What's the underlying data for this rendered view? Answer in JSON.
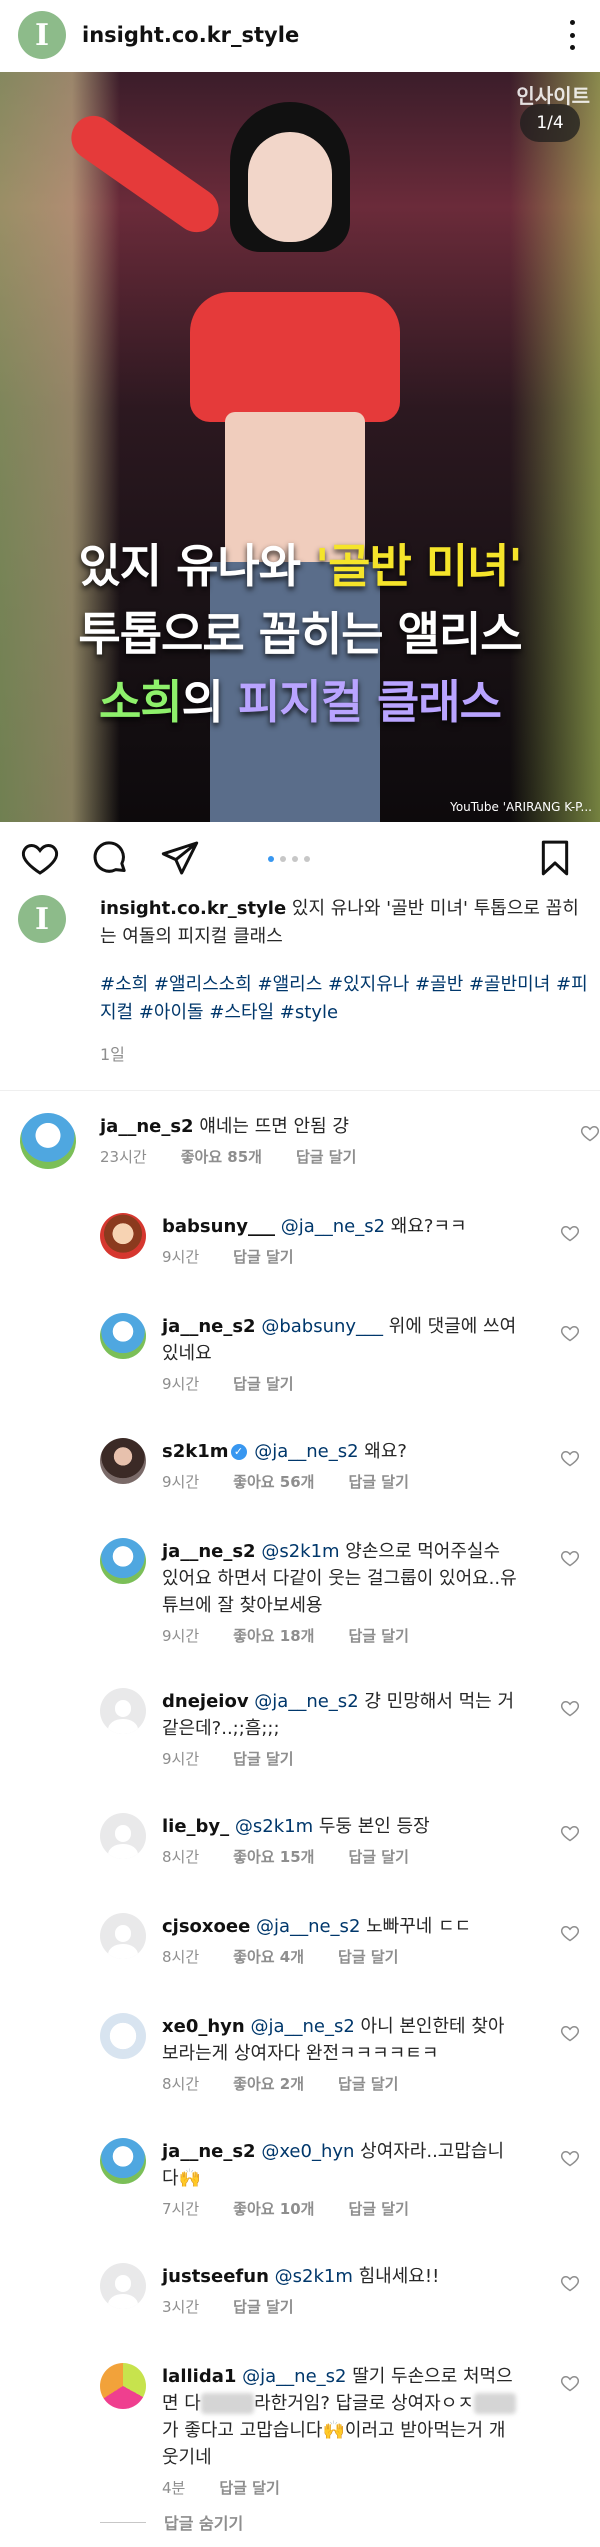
{
  "header": {
    "username": "insight.co.kr_style",
    "logo_letter": "I"
  },
  "media": {
    "counter": "1/4",
    "watermark": "인사이트",
    "caption_line1_a": "있지 유나와 ",
    "caption_line1_b": "'골반 미녀'",
    "caption_line2": "투톱으로 꼽히는 앨리스",
    "caption_line3_a": "소희",
    "caption_line3_b": "의 ",
    "caption_line3_c": "피지컬 클래스",
    "source": "YouTube 'ARIRANG K-P..."
  },
  "post": {
    "username": "insight.co.kr_style",
    "text": " 있지 유나와 '골반 미녀' 투톱으로 꼽히는 여돌의 피지컬 클래스",
    "tags": "#소희 #앨리스소희 #앨리스 #있지유나 #골반 #골반미녀 #피지컬 #아이돌 #스타일 #style",
    "time": "1일"
  },
  "comments": [
    {
      "user": "ja__ne_s2",
      "mention": "",
      "text": "얘네는 뜨면 안됨 걍",
      "time": "23시간",
      "likes": "좋아요 85개",
      "reply": "답글 달기"
    },
    {
      "user": "babsuny___",
      "mention": "@ja__ne_s2",
      "text": " 왜요?ㅋㅋ",
      "time": "9시간",
      "likes": "",
      "reply": "답글 달기"
    },
    {
      "user": "ja__ne_s2",
      "mention": "@babsuny___",
      "text": " 위에 댓글에 쓰여있네요",
      "time": "9시간",
      "likes": "",
      "reply": "답글 달기"
    },
    {
      "user": "s2k1m",
      "mention": "@ja__ne_s2",
      "text": " 왜요?",
      "time": "9시간",
      "likes": "좋아요 56개",
      "reply": "답글 달기"
    },
    {
      "user": "ja__ne_s2",
      "mention": "@s2k1m",
      "text": " 양손으로 먹어주실수 있어요 하면서 다같이 웃는 걸그룹이 있어요..유튜브에 잘 찾아보세용",
      "time": "9시간",
      "likes": "좋아요 18개",
      "reply": "답글 달기"
    },
    {
      "user": "dnejeiov",
      "mention": "@ja__ne_s2",
      "text": " 걍 민망해서 먹는 거같은데?..;;흠;;;",
      "time": "9시간",
      "likes": "",
      "reply": "답글 달기"
    },
    {
      "user": "lie_by_",
      "mention": "@s2k1m",
      "text": " 두둥 본인 등장",
      "time": "8시간",
      "likes": "좋아요 15개",
      "reply": "답글 달기"
    },
    {
      "user": "cjsoxoee",
      "mention": "@ja__ne_s2",
      "text": " 노빠꾸네 ㄷㄷ",
      "time": "8시간",
      "likes": "좋아요 4개",
      "reply": "답글 달기"
    },
    {
      "user": "xe0_hyn",
      "mention": "@ja__ne_s2",
      "text": " 아니 본인한테 찾아보라는게 상여자다 완전ㅋㅋㅋㅋㅌㅋ",
      "time": "8시간",
      "likes": "좋아요 2개",
      "reply": "답글 달기"
    },
    {
      "user": "ja__ne_s2",
      "mention": "@xe0_hyn",
      "text": " 상여자라..고맙습니다🙌",
      "time": "7시간",
      "likes": "좋아요 10개",
      "reply": "답글 달기"
    },
    {
      "user": "justseefun",
      "mention": "@s2k1m",
      "text": " 힘내세요!!",
      "time": "3시간",
      "likes": "",
      "reply": "답글 달기"
    },
    {
      "user": "lallida1",
      "mention": "@ja__ne_s2",
      "text": " 딸기 두손으로 처먹으면 다",
      "text_tail": "라한거임? 답글로 상여자ㅇㅈ",
      "text_tail2": "가 좋다고 고맙습니다🙌이러고 받아먹는거 개웃기네",
      "time": "4분",
      "likes": "",
      "reply": "답글 달기"
    }
  ],
  "hide_replies": "답글 숨기기",
  "colors": {
    "link": "#00376b",
    "meta": "#8e8e8e",
    "accent": "#3897f0"
  },
  "icons": [
    "heart-icon",
    "comment-icon",
    "share-icon",
    "bookmark-icon",
    "more-icon"
  ]
}
